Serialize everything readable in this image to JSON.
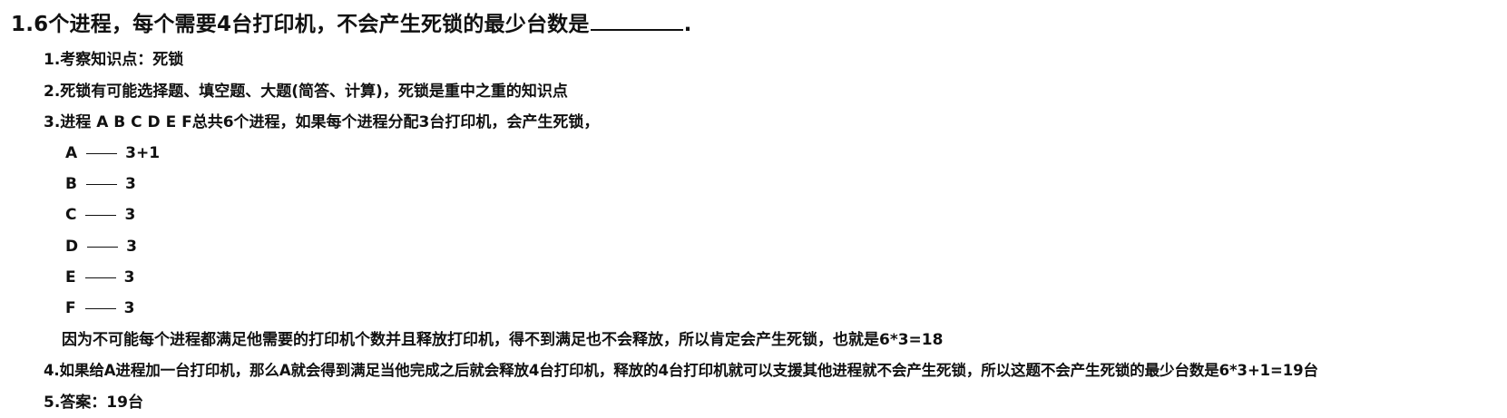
{
  "question": {
    "title_prefix": "1.6个进程，每个需要4台打印机，不会产生死锁的最少台数是",
    "title_suffix": "."
  },
  "notes": {
    "point1": "1.考察知识点：死锁",
    "point2": "2.死锁有可能选择题、填空题、大题(简答、计算)，死锁是重中之重的知识点",
    "point3": "3.进程 A B C D E F总共6个进程，如果每个进程分配3台打印机，会产生死锁，",
    "process_rows": [
      {
        "name": "A",
        "value": "3+1"
      },
      {
        "name": "B",
        "value": "3"
      },
      {
        "name": "C",
        "value": "3"
      },
      {
        "name": "D",
        "value": "3"
      },
      {
        "name": "E",
        "value": "3"
      },
      {
        "name": "F",
        "value": "3"
      }
    ],
    "explanation": "因为不可能每个进程都满足他需要的打印机个数并且释放打印机，得不到满足也不会释放，所以肯定会产生死锁，也就是6*3=18",
    "point4": "4.如果给A进程加一台打印机，那么A就会得到满足当他完成之后就会释放4台打印机，释放的4台打印机就可以支援其他进程就不会产生死锁，所以这题不会产生死锁的最少台数是6*3+1=19台",
    "point5": "5.答案：19台"
  }
}
